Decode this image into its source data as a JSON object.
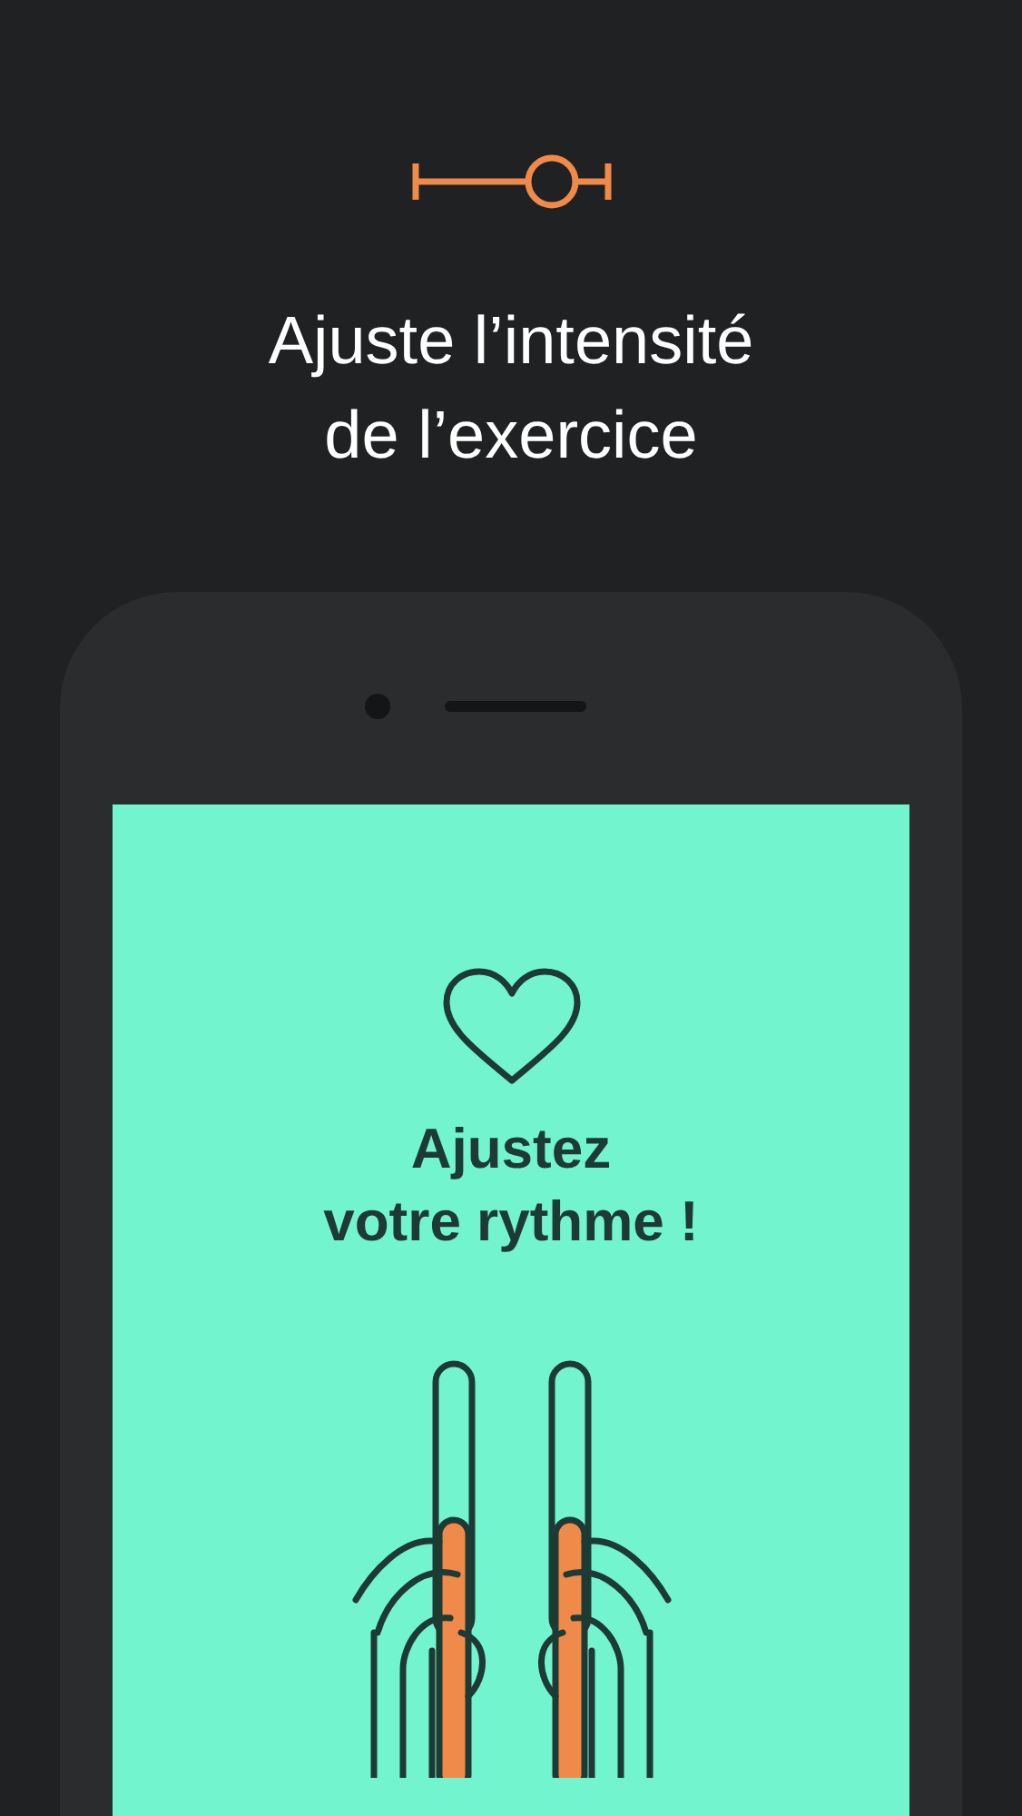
{
  "header": {
    "title_lines": [
      "Ajuste l’intensité",
      "de l’exercice"
    ]
  },
  "app_screen": {
    "heading_lines": [
      "Ajustez",
      "votre rythme !"
    ]
  }
}
